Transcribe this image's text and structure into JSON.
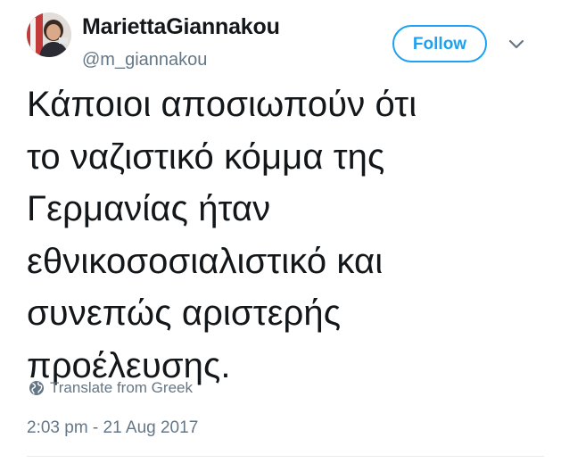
{
  "user": {
    "display_name": "MariettaGiannakou",
    "handle": "@m_giannakou"
  },
  "follow_button": {
    "label": "Follow"
  },
  "caret_icon": "chevron-down-icon",
  "tweet": {
    "lines": [
      "Κάποιοι αποσιωπούν ότι",
      "το ναζιστικό κόμμα της",
      "Γερμανίας ήταν",
      "εθνικοσοσιαλιστικό και",
      "συνεπώς αριστερής",
      "προέλευσης."
    ]
  },
  "translate": {
    "icon": "globe-icon",
    "label": "Translate from Greek"
  },
  "timestamp": "2:03 pm - 21 Aug 2017",
  "colors": {
    "accent": "#1da1f2",
    "text_primary": "#14171a",
    "text_secondary": "#657786",
    "divider": "#e6ecf0"
  }
}
